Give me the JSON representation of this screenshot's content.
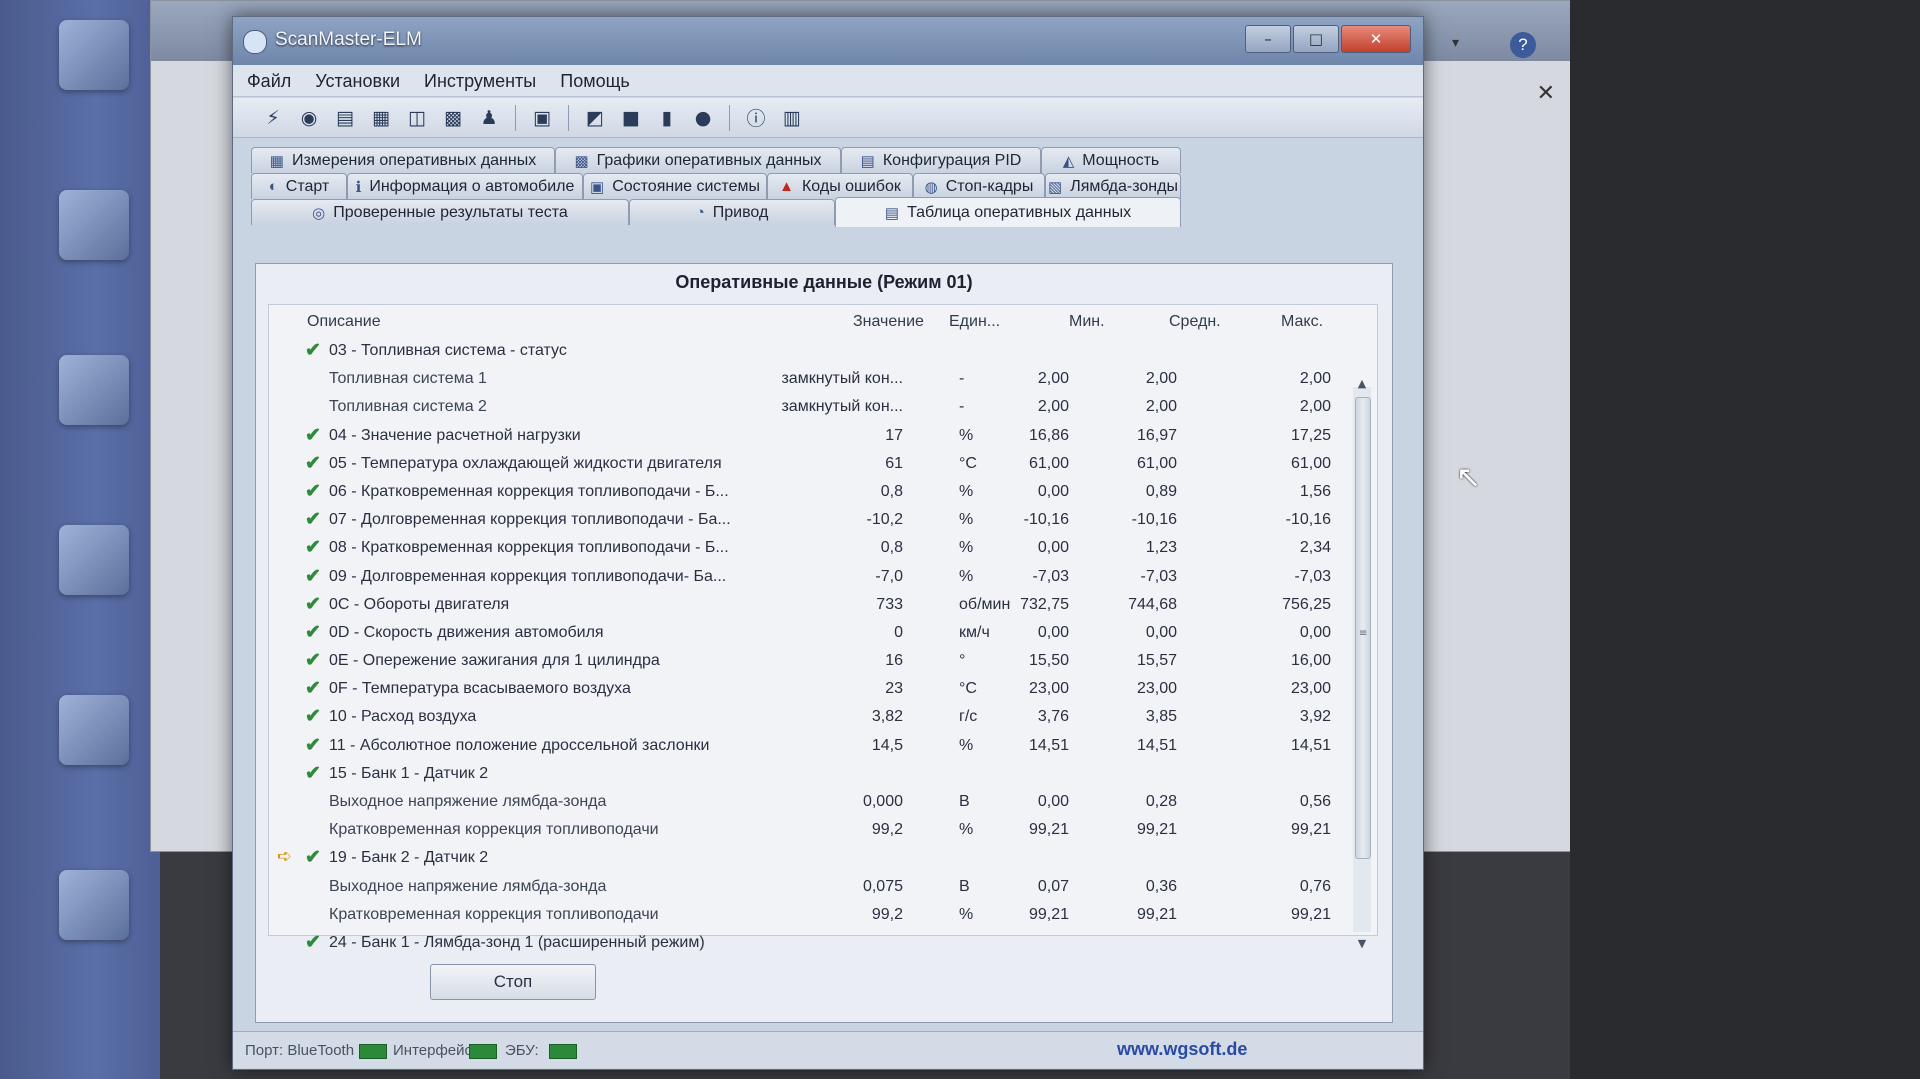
{
  "window": {
    "title": "ScanMaster-ELM",
    "minimize": "–",
    "maximize": "□",
    "close": "✕"
  },
  "menu": [
    "Файл",
    "Установки",
    "Инструменты",
    "Помощь"
  ],
  "tabs": {
    "row1": [
      {
        "label": "Измерения оперативных данных",
        "icon": "gauge-icon"
      },
      {
        "label": "Графики оперативных данных",
        "icon": "chart-icon"
      },
      {
        "label": "Конфигурация PID",
        "icon": "config-icon"
      },
      {
        "label": "Мощность",
        "icon": "power-icon"
      }
    ],
    "row2": [
      {
        "label": "Старт",
        "icon": "start-icon"
      },
      {
        "label": "Информация о автомобиле",
        "icon": "info-icon"
      },
      {
        "label": "Состояние системы",
        "icon": "system-icon"
      },
      {
        "label": "Коды ошибок",
        "icon": "warning-icon"
      },
      {
        "label": "Стоп-кадры",
        "icon": "freeze-frame-icon"
      },
      {
        "label": "Лямбда-зонды",
        "icon": "lambda-icon"
      }
    ],
    "row3": [
      {
        "label": "Проверенные результаты теста",
        "icon": "test-icon"
      },
      {
        "label": "Привод",
        "icon": "drive-icon"
      },
      {
        "label": "Таблица оперативных данных",
        "icon": "table-icon",
        "active": true
      }
    ]
  },
  "panel": {
    "title": "Оперативные данные (Режим 01)",
    "columns": {
      "description": "Описание",
      "value": "Значение",
      "unit": "Един...",
      "min": "Мин.",
      "avg": "Средн.",
      "max": "Макс."
    },
    "rows": [
      {
        "check": true,
        "desc": "03 - Топливная система - статус",
        "value": "",
        "unit": "",
        "min": "",
        "avg": "",
        "max": ""
      },
      {
        "check": false,
        "desc": "Топливная система 1",
        "value": "замкнутый кон...",
        "unit": "-",
        "min": "2,00",
        "avg": "2,00",
        "max": "2,00"
      },
      {
        "check": false,
        "desc": "Топливная система 2",
        "value": "замкнутый кон...",
        "unit": "-",
        "min": "2,00",
        "avg": "2,00",
        "max": "2,00"
      },
      {
        "check": true,
        "desc": "04 - Значение расчетной нагрузки",
        "value": "17",
        "unit": "%",
        "min": "16,86",
        "avg": "16,97",
        "max": "17,25"
      },
      {
        "check": true,
        "desc": "05 - Температура охлаждающей жидкости двигателя",
        "value": "61",
        "unit": "°C",
        "min": "61,00",
        "avg": "61,00",
        "max": "61,00"
      },
      {
        "check": true,
        "desc": "06 - Кратковременная коррекция топливоподачи - Б...",
        "value": "0,8",
        "unit": "%",
        "min": "0,00",
        "avg": "0,89",
        "max": "1,56"
      },
      {
        "check": true,
        "desc": "07 - Долговременная коррекция топливоподачи - Ба...",
        "value": "-10,2",
        "unit": "%",
        "min": "-10,16",
        "avg": "-10,16",
        "max": "-10,16"
      },
      {
        "check": true,
        "desc": "08 - Кратковременная коррекция топливоподачи - Б...",
        "value": "0,8",
        "unit": "%",
        "min": "0,00",
        "avg": "1,23",
        "max": "2,34"
      },
      {
        "check": true,
        "desc": "09 - Долговременная коррекция топливоподачи- Ба...",
        "value": "-7,0",
        "unit": "%",
        "min": "-7,03",
        "avg": "-7,03",
        "max": "-7,03"
      },
      {
        "check": true,
        "desc": "0C - Обороты двигателя",
        "value": "733",
        "unit": "об/мин",
        "min": "732,75",
        "avg": "744,68",
        "max": "756,25"
      },
      {
        "check": true,
        "desc": "0D - Скорость движения автомобиля",
        "value": "0",
        "unit": "км/ч",
        "min": "0,00",
        "avg": "0,00",
        "max": "0,00"
      },
      {
        "check": true,
        "desc": "0E - Опережение зажигания для 1 цилиндра",
        "value": "16",
        "unit": "°",
        "min": "15,50",
        "avg": "15,57",
        "max": "16,00"
      },
      {
        "check": true,
        "desc": "0F - Температура всасываемого воздуха",
        "value": "23",
        "unit": "°C",
        "min": "23,00",
        "avg": "23,00",
        "max": "23,00"
      },
      {
        "check": true,
        "desc": "10 - Расход воздуха",
        "value": "3,82",
        "unit": "г/с",
        "min": "3,76",
        "avg": "3,85",
        "max": "3,92"
      },
      {
        "check": true,
        "desc": "11 - Абсолютное положение дроссельной заслонки",
        "value": "14,5",
        "unit": "%",
        "min": "14,51",
        "avg": "14,51",
        "max": "14,51"
      },
      {
        "check": true,
        "desc": "15 - Банк 1 - Датчик 2",
        "value": "",
        "unit": "",
        "min": "",
        "avg": "",
        "max": ""
      },
      {
        "check": false,
        "desc": "Выходное напряжение лямбда-зонда",
        "value": "0,000",
        "unit": "В",
        "min": "0,00",
        "avg": "0,28",
        "max": "0,56"
      },
      {
        "check": false,
        "desc": "Кратковременная коррекция топливоподачи",
        "value": "99,2",
        "unit": "%",
        "min": "99,21",
        "avg": "99,21",
        "max": "99,21"
      },
      {
        "check": true,
        "arrow": true,
        "desc": "19 - Банк 2 - Датчик 2",
        "value": "",
        "unit": "",
        "min": "",
        "avg": "",
        "max": ""
      },
      {
        "check": false,
        "desc": "Выходное напряжение лямбда-зонда",
        "value": "0,075",
        "unit": "В",
        "min": "0,07",
        "avg": "0,36",
        "max": "0,76"
      },
      {
        "check": false,
        "desc": "Кратковременная коррекция топливоподачи",
        "value": "99,2",
        "unit": "%",
        "min": "99,21",
        "avg": "99,21",
        "max": "99,21"
      },
      {
        "check": true,
        "desc": "24 - Банк 1 - Лямбда-зонд 1 (расширенный режим)",
        "value": "",
        "unit": "",
        "min": "",
        "avg": "",
        "max": ""
      }
    ],
    "stop_label": "Стоп"
  },
  "status": {
    "port_label": "Порт: BlueTooth",
    "interface_label": "Интерфейс:",
    "ecu_label": "ЭБУ:",
    "led_color": "#2b8a3a",
    "website": "www.wgsoft.de"
  }
}
